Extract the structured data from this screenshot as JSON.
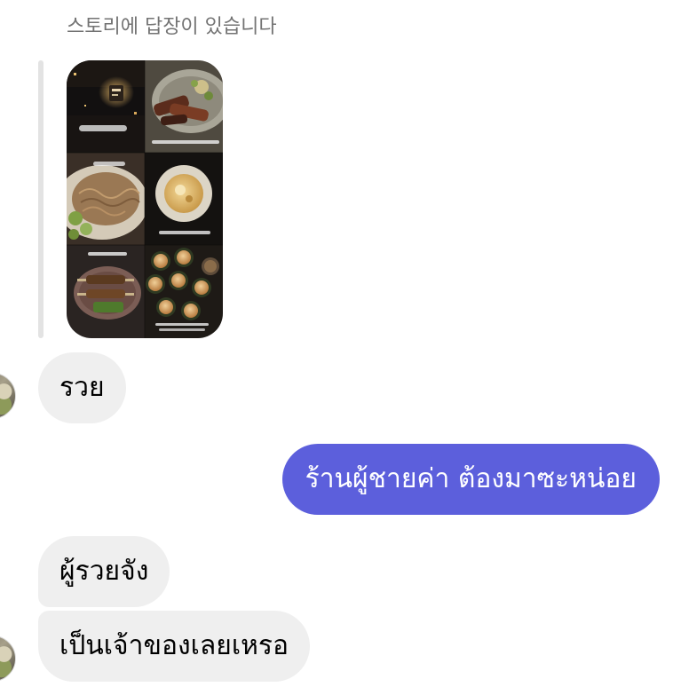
{
  "header": {
    "story_reply_notice": "스토리에 답장이 있습니다"
  },
  "story": {
    "image_icon": "story-food-collage-image"
  },
  "messages": [
    {
      "direction": "received",
      "text": "รวย",
      "show_avatar": true
    },
    {
      "direction": "sent",
      "text": "ร้านผู้ชายค่า ต้องมาซะหน่อย"
    },
    {
      "direction": "received",
      "text": "ผู้รวยจัง",
      "show_avatar": false
    },
    {
      "direction": "received",
      "text": "เป็นเจ้าของเลยเหรอ",
      "show_avatar": true
    }
  ],
  "icons": {
    "avatar": "user-avatar-icon"
  },
  "colors": {
    "background": "#ffffff",
    "sent_bubble": "#5c5fdc",
    "sent_text": "#ffffff",
    "received_bubble": "#efefef",
    "received_text": "#000000",
    "notice_text": "#737373",
    "reply_bar": "#e3e3e3"
  }
}
